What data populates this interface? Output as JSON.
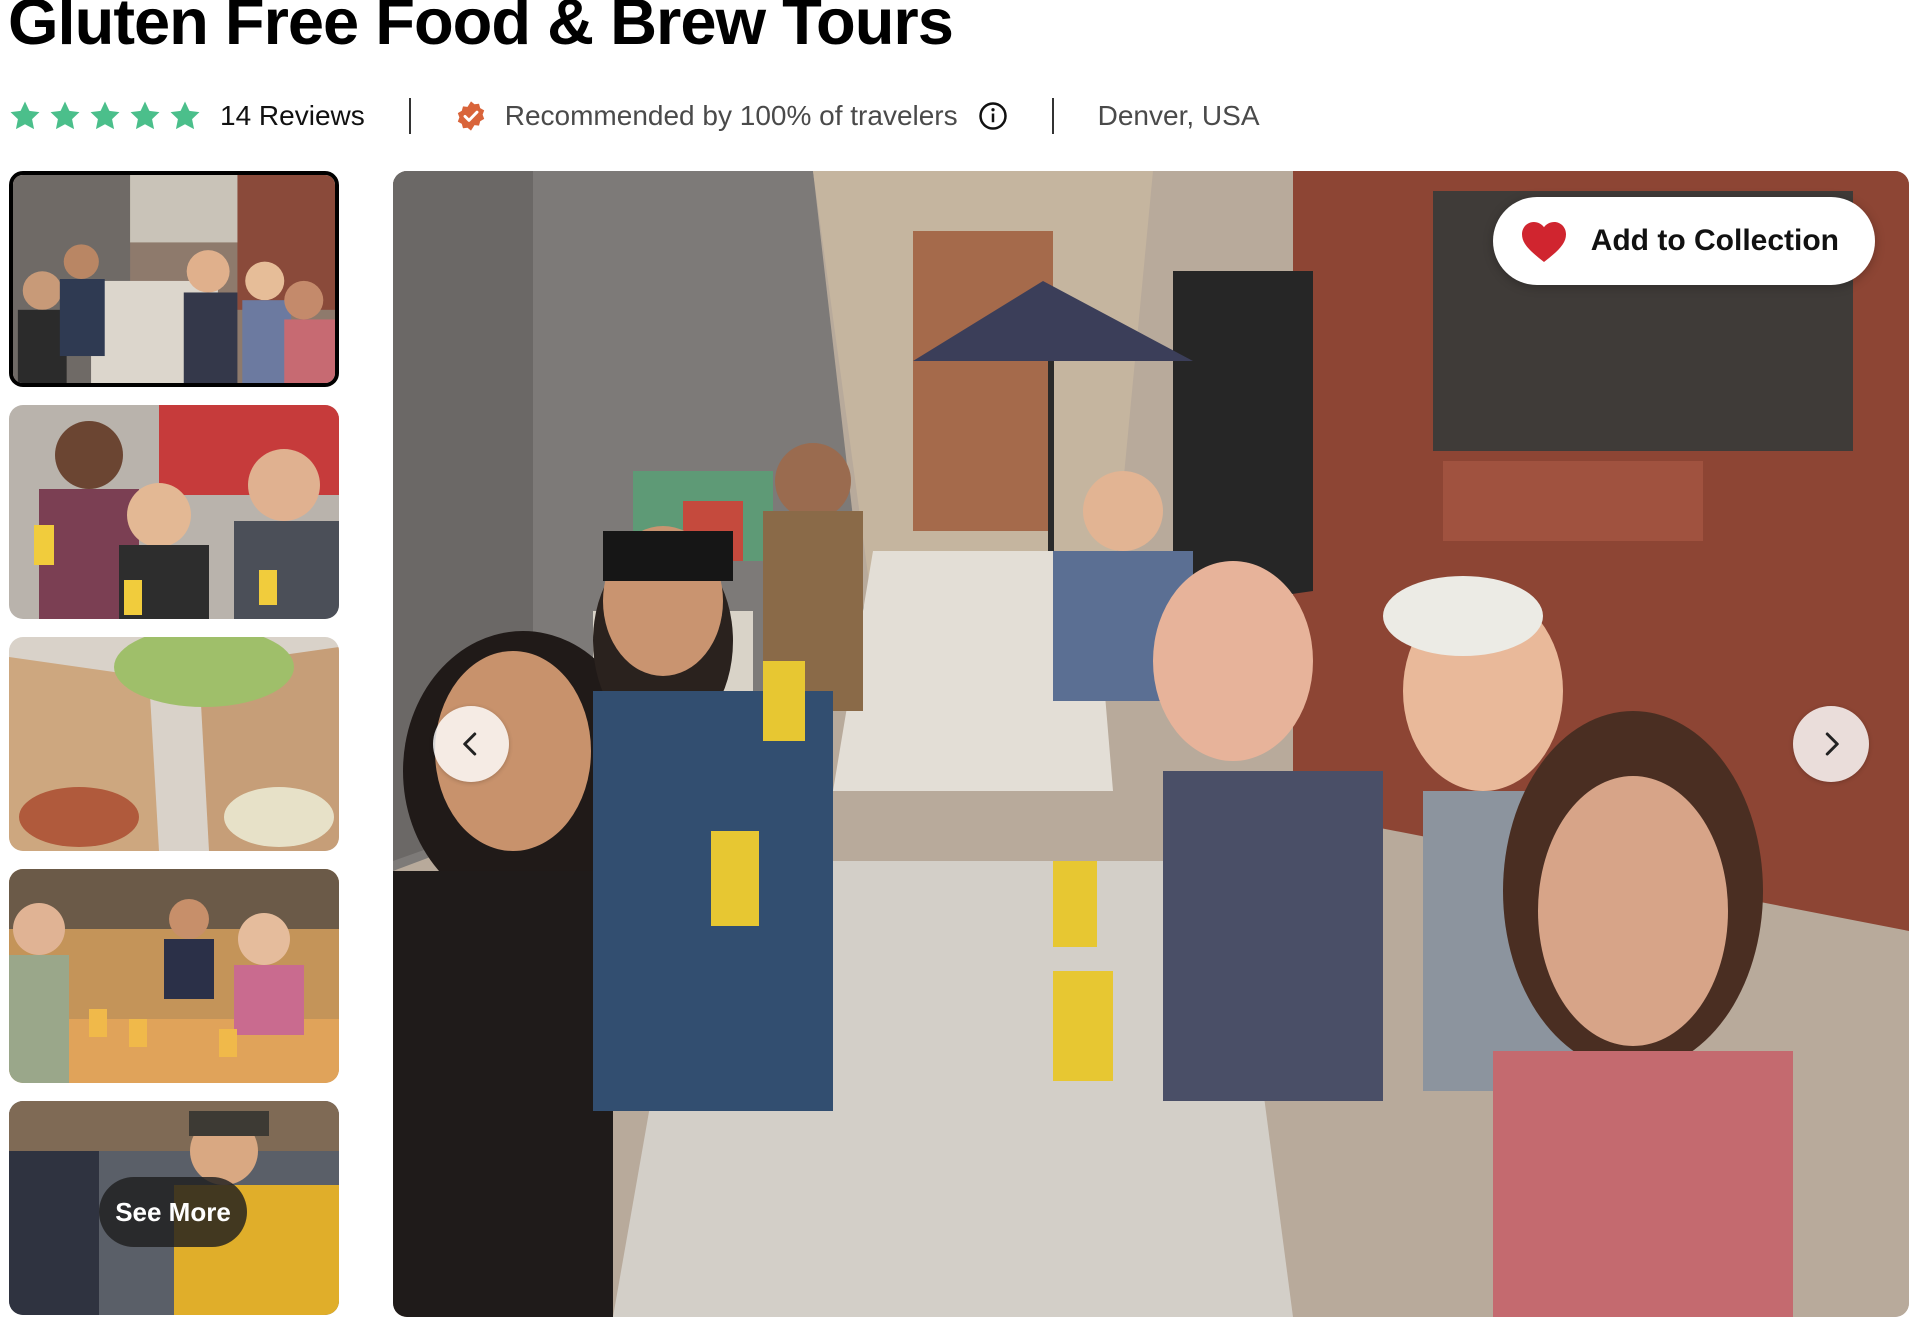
{
  "header": {
    "title": "Gluten Free Food & Brew Tours"
  },
  "meta": {
    "rating_stars": 5,
    "star_color": "#4bbf8b",
    "reviews_label": "14 Reviews",
    "recommend_label": "Recommended by 100% of travelers",
    "badge_color": "#d9643a",
    "location": "Denver, USA"
  },
  "gallery": {
    "thumbnails": [
      {
        "name": "group-at-picnic-table",
        "selected": true
      },
      {
        "name": "three-friends-smiling",
        "selected": false
      },
      {
        "name": "gluten-free-wraps",
        "selected": false
      },
      {
        "name": "friends-with-beer-flight",
        "selected": false
      },
      {
        "name": "brewery-crowd",
        "selected": false
      }
    ],
    "see_more_label": "See More",
    "add_collection_label": "Add to Collection",
    "heart_color": "#d0252f"
  }
}
